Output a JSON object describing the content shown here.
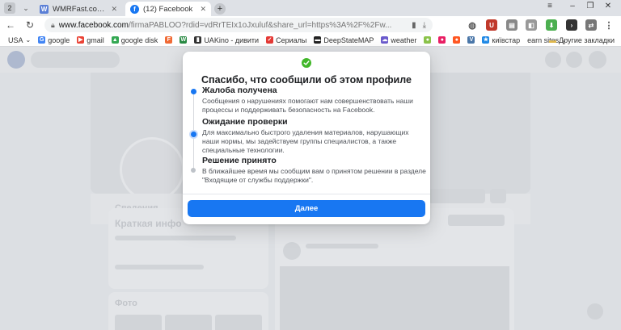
{
  "browser": {
    "tab_counter": "2",
    "tabs": [
      {
        "title": "WMRFast.com - лучшее м"
      },
      {
        "title": "(12) Facebook"
      }
    ],
    "address": {
      "domain": "www.facebook.com",
      "path": "/firmaPABLOO?rdid=vdRrTEIx1oJxuluf&share_url=https%3A%2F%2Fw..."
    },
    "bookmarks": [
      {
        "label": "USA",
        "icon": "chevron-down",
        "color": "#555555"
      },
      {
        "label": "google",
        "icon": "G",
        "color": "#4285f4"
      },
      {
        "label": "gmail",
        "icon": "M",
        "color": "#ea4335"
      },
      {
        "label": "google disk",
        "icon": "D",
        "color": "#34a853"
      },
      {
        "label": "",
        "icon": "F",
        "color": "#f06a35"
      },
      {
        "label": "",
        "icon": "W",
        "color": "#2a8a44"
      },
      {
        "label": "UAKino - дивити",
        "icon": "U",
        "color": "#333333"
      },
      {
        "label": "Сериалы",
        "icon": "S",
        "color": "#e53935"
      },
      {
        "label": "DeepStateMAP",
        "icon": "D",
        "color": "#222222"
      },
      {
        "label": "weather",
        "icon": "W",
        "color": "#6a5acd"
      },
      {
        "label": "",
        "icon": "V",
        "color": "#4a76a8"
      },
      {
        "label": "київстар",
        "icon": "K",
        "color": "#1e88e5"
      },
      {
        "label": "earn sites",
        "icon": "chevron-down",
        "color": "#555555"
      }
    ],
    "other_bookmarks": "Другие закладки"
  },
  "modal": {
    "title": "Спасибо, что сообщили об этом профиле",
    "steps": [
      {
        "title": "Жалоба получена",
        "text": "Сообщения о нарушениях помогают нам совершенствовать наши процессы и поддерживать безопасность на Facebook."
      },
      {
        "title": "Ожидание проверки",
        "text": "Для максимально быстрого удаления материалов, нарушающих наши нормы, мы задействуем группы специалистов, а также специальные технологии."
      },
      {
        "title": "Решение принято",
        "text": "В ближайшее время мы сообщим вам о принятом решении в разделе \"Входящие от службы поддержки\"."
      }
    ],
    "next_button": "Далее"
  },
  "background": {
    "tab_about": "Сведения",
    "card_heading": "Краткая инфо",
    "photos_heading": "Фото"
  }
}
